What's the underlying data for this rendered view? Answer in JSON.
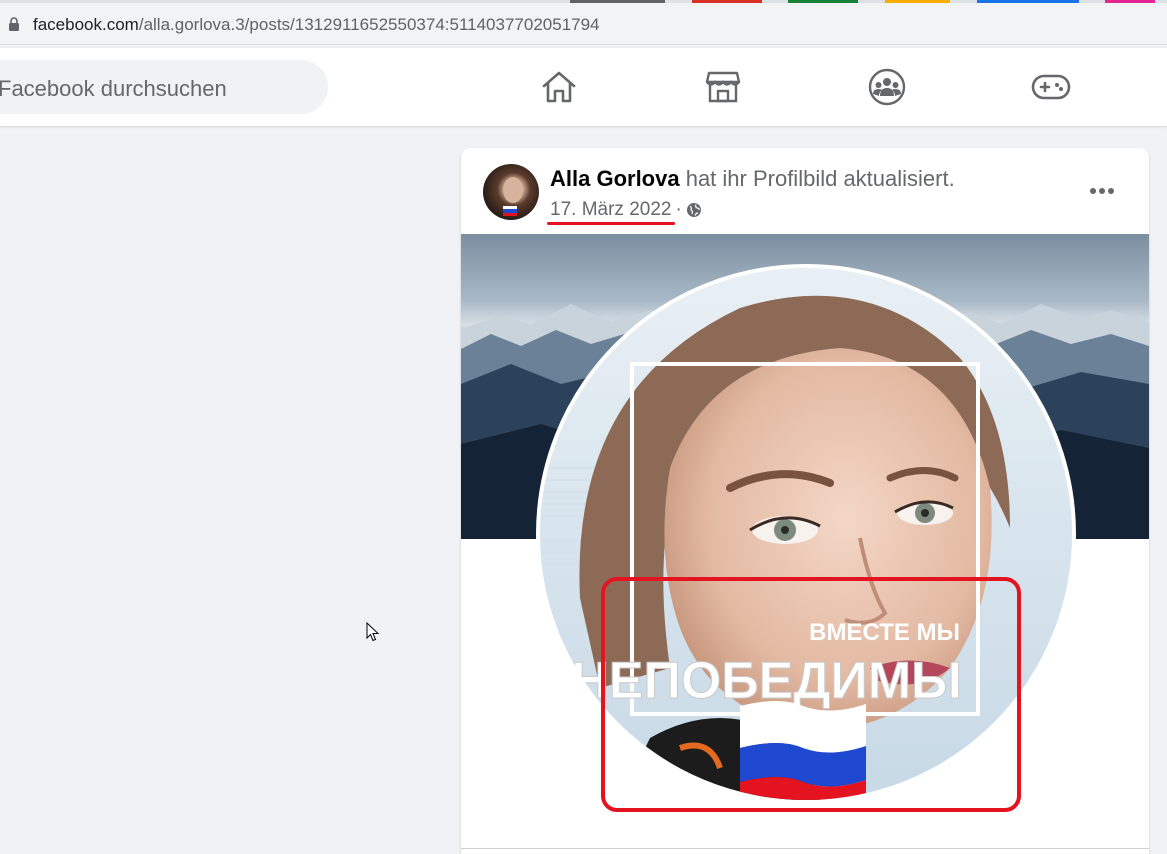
{
  "browser": {
    "url_host": "facebook.com",
    "url_path": "/alla.gorlova.3/posts/1312911652550374:5114037702051794",
    "tab_colors": [
      "#5f6368",
      "#d93025",
      "#188038",
      "#f9ab00",
      "#1a73e8",
      "#e52592"
    ]
  },
  "header": {
    "search_placeholder": "Facebook durchsuchen",
    "nav_icons": [
      "home-icon",
      "marketplace-icon",
      "groups-icon",
      "gaming-icon"
    ]
  },
  "post": {
    "author": "Alla Gorlova",
    "action": " hat ihr Profilbild aktualisiert.",
    "date": "17. März 2022",
    "separator": "·",
    "privacy_icon": "globe-icon",
    "image_text": {
      "line1": "ВМЕСТЕ МЫ",
      "line2": "#НЕПОБЕДИМЫ"
    },
    "flag_colors": [
      "#ffffff",
      "#1f48d1",
      "#e3141f"
    ]
  },
  "annotation": {
    "highlight_color": "#e3141f"
  }
}
